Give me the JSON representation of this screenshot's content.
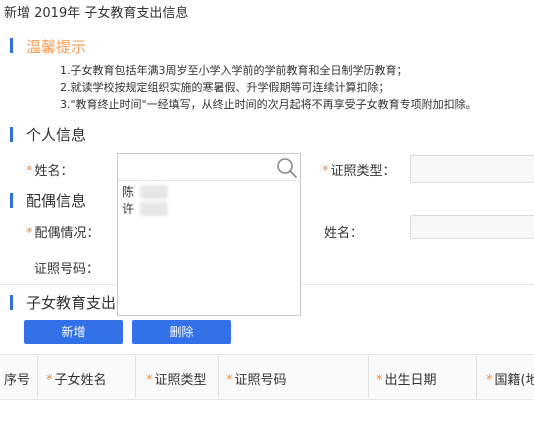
{
  "window": {
    "title": "新增 2019年 子女教育支出信息"
  },
  "tips": {
    "title": "温馨提示",
    "lines": [
      "1.子女教育包括年满3周岁至小学入学前的学前教育和全日制学历教育；",
      "2.就读学校按规定组织实施的寒暑假、升学假期等可连续计算扣除；",
      "3.\"教育终止时间\"一经填写，从终止时间的次月起将不再享受子女教育专项附加扣除。"
    ]
  },
  "personal": {
    "title": "个人信息",
    "star": "*",
    "name_label": "姓名：",
    "id_type_label": "证照类型："
  },
  "spouse": {
    "title": "配偶信息",
    "status_label": "配偶情况：",
    "name_label": "姓名：",
    "id_number_label": "证照号码："
  },
  "children": {
    "title": "子女教育支出",
    "add_label": "新增",
    "delete_label": "删除",
    "columns": [
      "序号",
      "子女姓名",
      "证照类型",
      "证照号码",
      "出生日期",
      "国籍(地"
    ]
  },
  "dropdown": {
    "items": [
      "陈",
      "许"
    ]
  },
  "colors": {
    "accent": "#3271e8",
    "required": "#f08a3c",
    "tips": "#f5a05a"
  }
}
